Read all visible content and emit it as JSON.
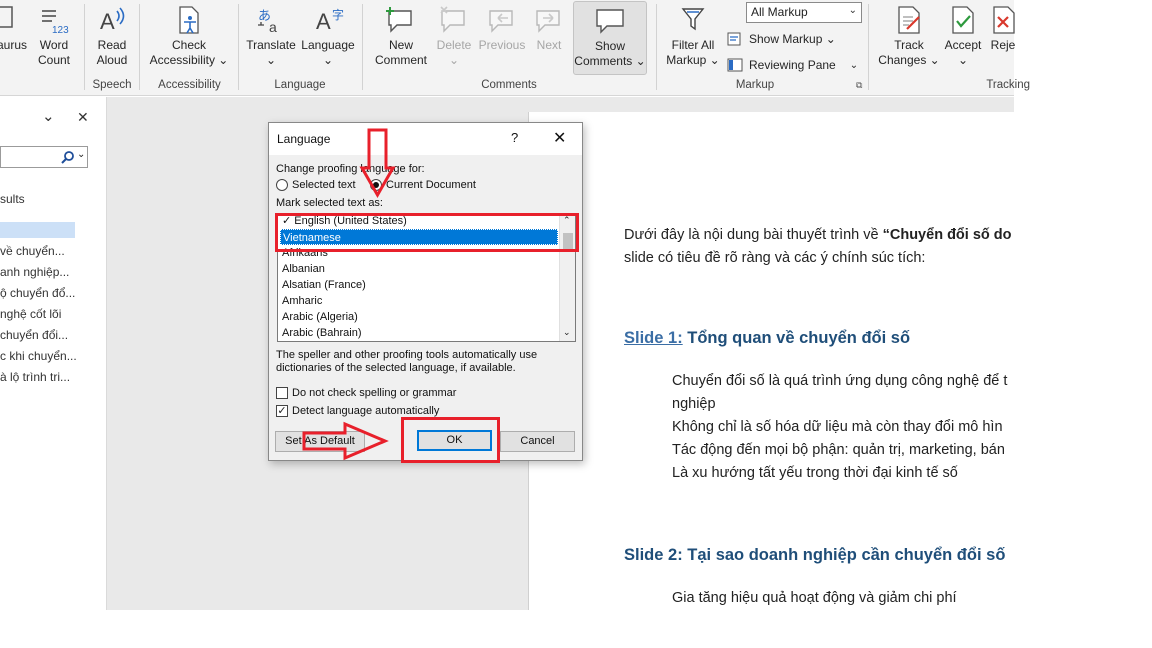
{
  "ribbon": {
    "buttons": {
      "thesaurus": "aurus",
      "word_count": "Word\nCount",
      "read_aloud": "Read\nAloud",
      "check_accessibility": "Check\nAccessibility ⌄",
      "translate": "Translate\n⌄",
      "language": "Language\n⌄",
      "new_comment": "New\nComment",
      "delete": "Delete\n⌄",
      "previous": "Previous",
      "next": "Next",
      "show_comments": "Show\nComments ⌄",
      "filter_all_markup": "Filter All\nMarkup ⌄",
      "track_changes": "Track\nChanges ⌄",
      "accept": "Accept\n⌄",
      "reject": "Reje"
    },
    "markup_dropdown": "All Markup",
    "show_markup": "Show Markup ⌄",
    "reviewing_pane": "Reviewing Pane",
    "groups": {
      "speech": "Speech",
      "accessibility": "Accessibility",
      "language": "Language",
      "comments": "Comments",
      "markup": "Markup",
      "tracking": "Tracking"
    }
  },
  "nav": {
    "results_label": "sults",
    "items": [
      "về chuyển...",
      "anh nghiệp...",
      "ộ chuyển đổ...",
      "nghệ cốt lõi",
      "chuyển đổi...",
      "c khi chuyển...",
      "à lộ trình tri..."
    ]
  },
  "dialog": {
    "title": "Language",
    "help": "?",
    "change_proofing": "Change proofing language for:",
    "radio_selected_text": "Selected text",
    "radio_current_document": "Current Document",
    "mark_selected": "Mark selected text as:",
    "languages": [
      "English (United States)",
      "Vietnamese",
      "Afrikaans",
      "Albanian",
      "Alsatian (France)",
      "Amharic",
      "Arabic (Algeria)",
      "Arabic (Bahrain)"
    ],
    "info_line1": "The speller and other proofing tools automatically use",
    "info_line2": "dictionaries of the selected language, if available.",
    "check_no_spelling": "Do not check spelling or grammar",
    "check_detect": "Detect language automatically",
    "btn_default": "Set As Default",
    "btn_ok": "OK",
    "btn_cancel": "Cancel"
  },
  "document": {
    "intro_1a": "Dưới đây là nội dung bài thuyết trình về ",
    "intro_1b": "“Chuyển đổi số do",
    "intro_2": "slide có tiêu đề rõ ràng và các ý chính súc tích:",
    "slide1_label": "Slide 1:",
    "slide1_title": " Tổng quan về chuyển đổi số",
    "bullets1": [
      "Chuyển đổi số là quá trình ứng dụng công nghệ để t",
      "nghiệp",
      "Không chỉ là số hóa dữ liệu mà còn thay đổi mô hìn",
      "Tác động đến mọi bộ phận: quản trị, marketing, bán",
      "Là xu hướng tất yếu trong thời đại kinh tế số"
    ],
    "slide2_title": "Slide 2: Tại sao doanh nghiệp cần chuyển đổi số",
    "bullets2": [
      "Gia tăng hiệu quả hoạt động và giảm chi phí"
    ]
  },
  "colors": {
    "annotation_red": "#e8202b",
    "selection_blue": "#0078d7",
    "heading_blue": "#1f4e79"
  }
}
